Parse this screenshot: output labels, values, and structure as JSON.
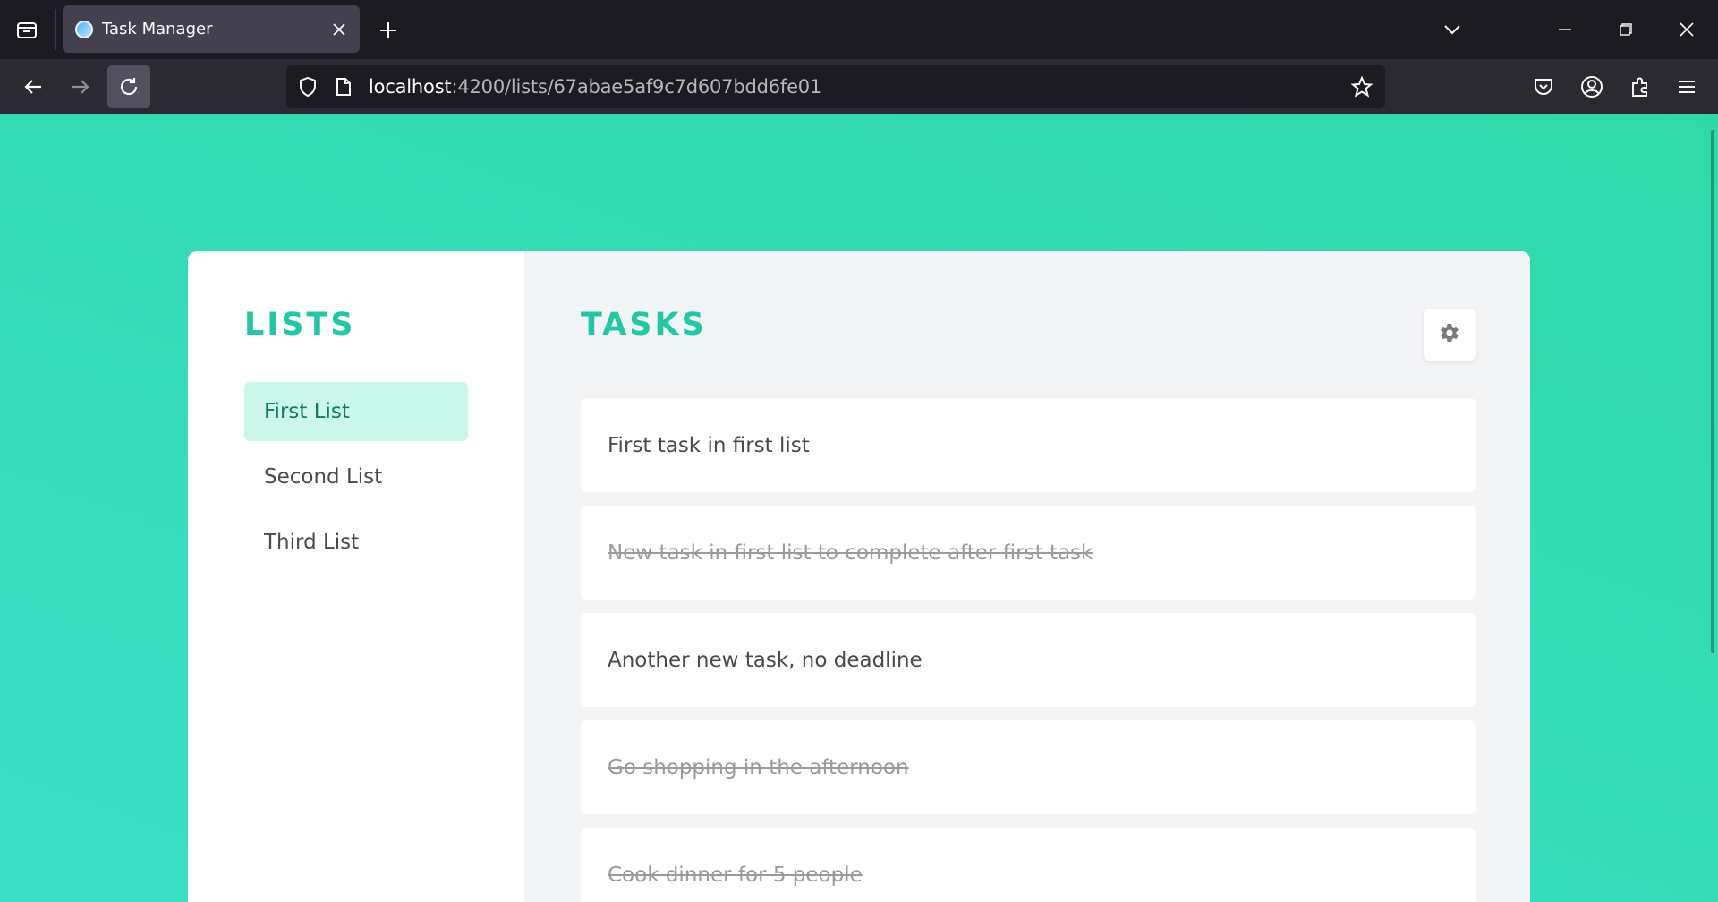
{
  "browser": {
    "tab_title": "Task Manager",
    "url_host": "localhost",
    "url_rest": ":4200/lists/67abae5af9c7d607bdd6fe01"
  },
  "lists": {
    "title": "LISTS",
    "items": [
      {
        "label": "First List",
        "active": true
      },
      {
        "label": "Second List",
        "active": false
      },
      {
        "label": "Third List",
        "active": false
      }
    ]
  },
  "tasks": {
    "title": "TASKS",
    "items": [
      {
        "label": "First task in first list",
        "completed": false
      },
      {
        "label": "New task in first list to complete after first task",
        "completed": true
      },
      {
        "label": "Another new task, no deadline",
        "completed": false
      },
      {
        "label": "Go shopping in the afternoon",
        "completed": true
      },
      {
        "label": "Cook dinner for 5 people",
        "completed": true
      }
    ]
  },
  "colors": {
    "accent": "#1fc9a4",
    "active_list_bg": "#ccf7eb",
    "background_gradient_start": "#2fd9a7",
    "background_gradient_end": "#3ddfc6"
  },
  "icons": {
    "settings": "gear-icon"
  }
}
